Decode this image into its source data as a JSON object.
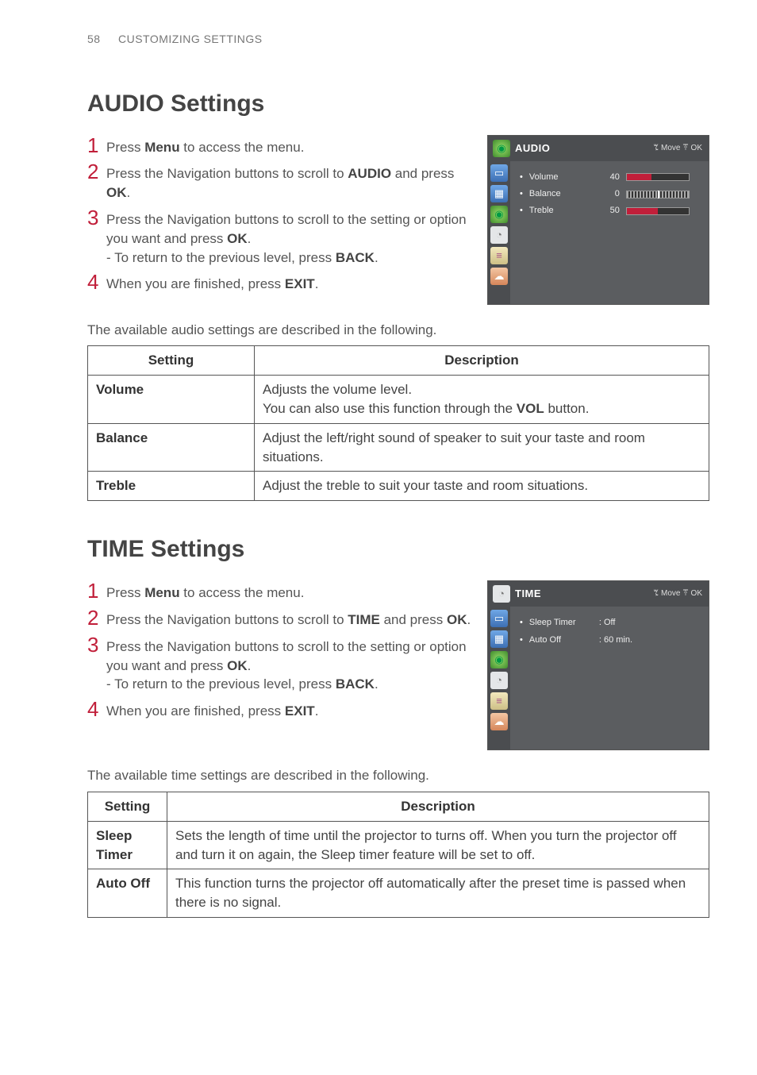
{
  "page": {
    "number": "58",
    "breadcrumb": "CUSTOMIZING SETTINGS"
  },
  "audio": {
    "title": "AUDIO Settings",
    "steps": {
      "s1a": "Press ",
      "s1b": "Menu",
      "s1c": " to access the menu.",
      "s2a": "Press the Navigation buttons to scroll to ",
      "s2b": "AUDIO",
      "s2c": " and press ",
      "s2d": "OK",
      "s2e": ".",
      "s3a": "Press the Navigation buttons to scroll to the setting or option you want and press ",
      "s3b": "OK",
      "s3c": ".",
      "s3sub_a": "- To return to the previous level, press ",
      "s3sub_b": "BACK",
      "s3sub_c": ".",
      "s4a": "When you are finished, press ",
      "s4b": "EXIT",
      "s4c": "."
    },
    "intro": "The available audio settings are described in the following.",
    "table": {
      "h1": "Setting",
      "h2": "Description",
      "r1c1": "Volume",
      "r1c2a": "Adjusts the volume level.",
      "r1c2b": "You can also use this function through the ",
      "r1c2c": "VOL",
      "r1c2d": " button.",
      "r2c1": "Balance",
      "r2c2": "Adjust the left/right sound of speaker to suit your taste and room situations.",
      "r3c1": "Treble",
      "r3c2": "Adjust the treble to suit your taste and room situations."
    },
    "osd": {
      "title": "AUDIO",
      "nav": "ꔂ Move   ꔉ OK",
      "rows": [
        {
          "label": "Volume",
          "value": "40",
          "fill": 40
        },
        {
          "label": "Balance",
          "value": "0",
          "balance": true
        },
        {
          "label": "Treble",
          "value": "50",
          "fill": 50
        }
      ]
    }
  },
  "time": {
    "title": "TIME Settings",
    "steps": {
      "s1a": "Press ",
      "s1b": "Menu",
      "s1c": " to access the menu.",
      "s2a": "Press the Navigation buttons to scroll to ",
      "s2b": "TIME",
      "s2c": " and press ",
      "s2d": "OK",
      "s2e": ".",
      "s3a": "Press the Navigation buttons to scroll to the setting or option you want and press ",
      "s3b": "OK",
      "s3c": ".",
      "s3sub_a": "- To return to the previous level, press ",
      "s3sub_b": "BACK",
      "s3sub_c": ".",
      "s4a": "When you are finished, press ",
      "s4b": "EXIT",
      "s4c": "."
    },
    "intro": "The available time settings are described in the following.",
    "table": {
      "h1": "Setting",
      "h2": "Description",
      "r1c1": "Sleep Timer",
      "r1c2": "Sets the length of time until the projector to turns off. When you turn the projector off and turn it on again, the Sleep timer feature will be set to off.",
      "r2c1": "Auto Off",
      "r2c2": "This function turns the projector off automatically after the preset time is passed when there is no signal."
    },
    "osd": {
      "title": "TIME",
      "nav": "ꔂ Move   ꔉ OK",
      "rows": [
        {
          "label": "Sleep Timer",
          "text": ": Off"
        },
        {
          "label": "Auto Off",
          "text": ": 60 min."
        }
      ]
    }
  }
}
